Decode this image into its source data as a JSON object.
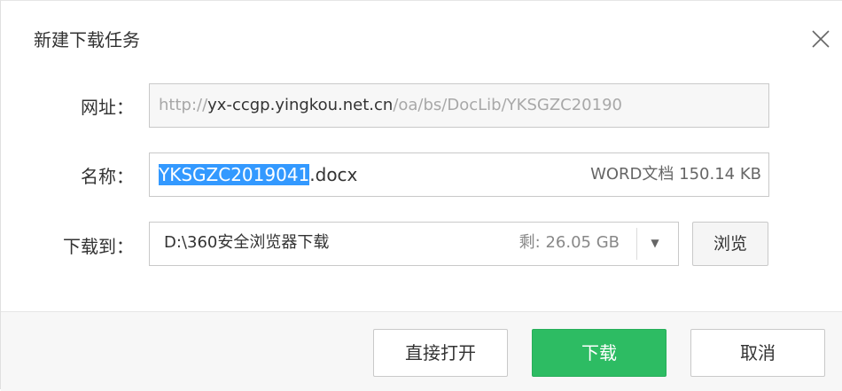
{
  "dialog": {
    "title": "新建下载任务",
    "close_icon": "close-icon"
  },
  "url_row": {
    "label": "网址：",
    "url_prefix": "http://",
    "url_host": "yx-ccgp.yingkou.net.cn",
    "url_path": "/oa/bs/DocLib/YKSGZC20190"
  },
  "name_row": {
    "label": "名称：",
    "filename_selected": "YKSGZC2019041",
    "filename_ext": ".docx",
    "file_meta": "WORD文档 150.14 KB"
  },
  "save_row": {
    "label": "下载到：",
    "path": "D:\\360安全浏览器下载",
    "free_space": "剩: 26.05 GB",
    "dropdown_icon": "chevron-down-icon",
    "browse_label": "浏览"
  },
  "buttons": {
    "open": "直接打开",
    "download": "下载",
    "cancel": "取消"
  },
  "colors": {
    "download_button": "#2dbc63",
    "selection": "#3399ff"
  }
}
